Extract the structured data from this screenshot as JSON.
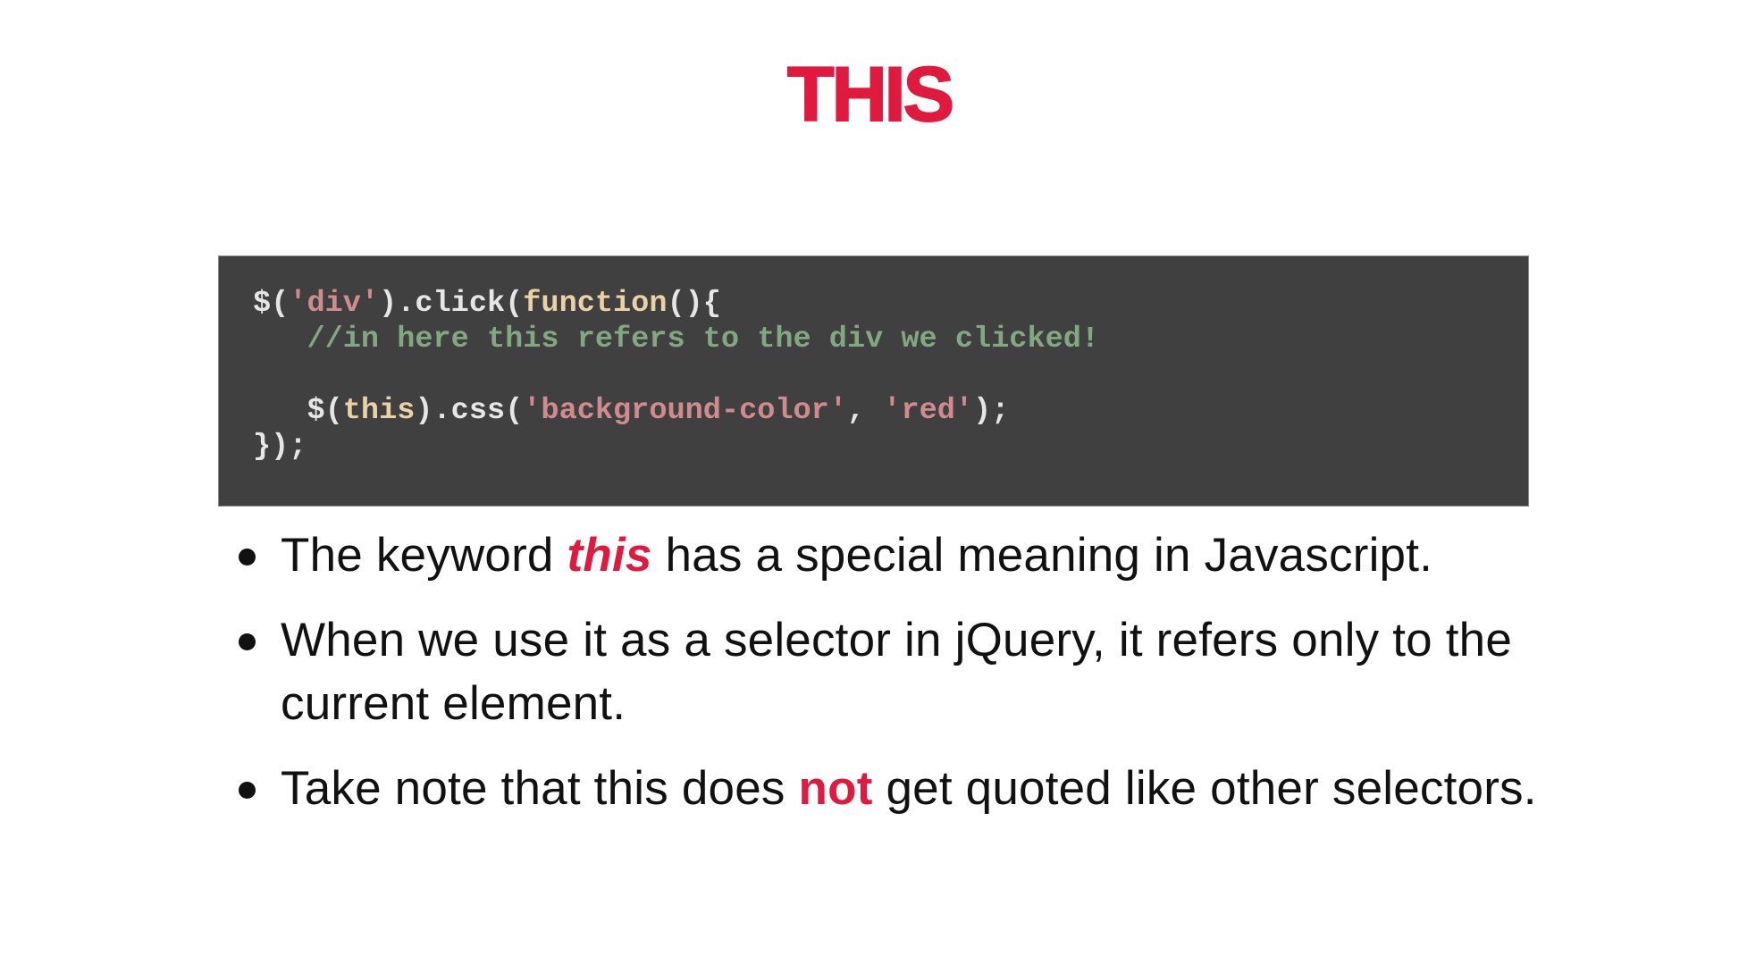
{
  "slide": {
    "title": "THIS",
    "accent_color": "#E01A3F"
  },
  "code": {
    "colors": {
      "background": "#404040",
      "default": "#E6E6E6",
      "string": "#D08C8C",
      "keyword": "#E8D2A6",
      "comment": "#82A882"
    },
    "lines": [
      [
        {
          "type": "plain",
          "text": "$("
        },
        {
          "type": "str",
          "text": "'div'"
        },
        {
          "type": "plain",
          "text": ").click("
        },
        {
          "type": "kw",
          "text": "function"
        },
        {
          "type": "plain",
          "text": "(){"
        }
      ],
      [
        {
          "type": "plain",
          "text": "   "
        },
        {
          "type": "cm",
          "text": "//in here this refers to the div we clicked!"
        }
      ],
      [
        {
          "type": "plain",
          "text": ""
        }
      ],
      [
        {
          "type": "plain",
          "text": "   $("
        },
        {
          "type": "kw",
          "text": "this"
        },
        {
          "type": "plain",
          "text": ").css("
        },
        {
          "type": "str",
          "text": "'background-color'"
        },
        {
          "type": "plain",
          "text": ", "
        },
        {
          "type": "str",
          "text": "'red'"
        },
        {
          "type": "plain",
          "text": ");"
        }
      ],
      [
        {
          "type": "plain",
          "text": "});"
        }
      ]
    ]
  },
  "bullets": [
    {
      "before": "The keyword ",
      "emphasis": "this",
      "emphasis_style": "bold-italic",
      "after": " has a special meaning in Javascript."
    },
    {
      "before": "When we use it as a selector in jQuery, it refers only to the current element.",
      "emphasis": "",
      "emphasis_style": "",
      "after": ""
    },
    {
      "before": "Take note that this does ",
      "emphasis": "not",
      "emphasis_style": "bold",
      "after": " get quoted like other selectors."
    }
  ]
}
